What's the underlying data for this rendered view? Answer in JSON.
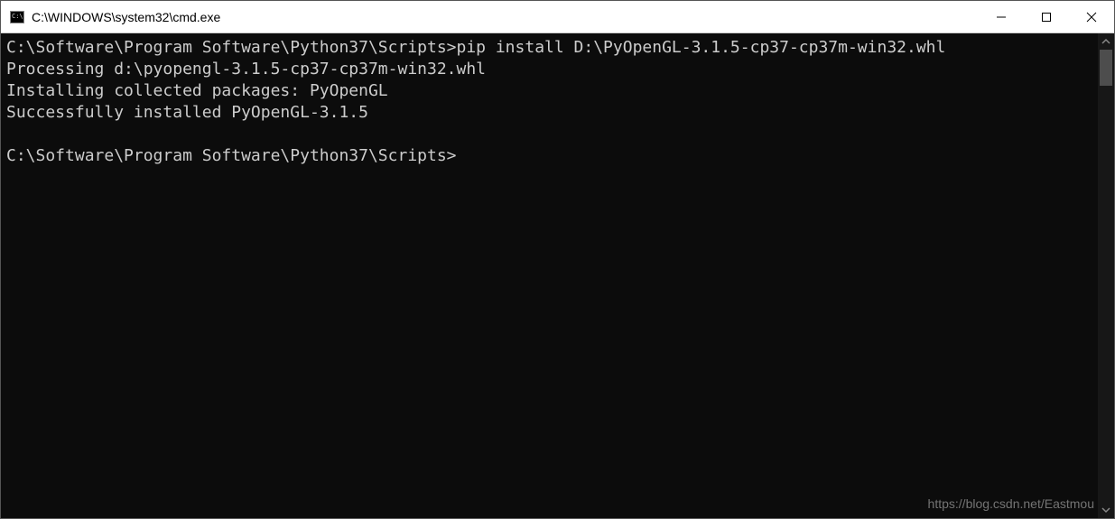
{
  "titlebar": {
    "title": "C:\\WINDOWS\\system32\\cmd.exe"
  },
  "console": {
    "lines": [
      {
        "prompt": "C:\\Software\\Program Software\\Python37\\Scripts>",
        "command": "pip install D:\\PyOpenGL-3.1.5-cp37-cp37m-win32.whl"
      },
      {
        "text": "Processing d:\\pyopengl-3.1.5-cp37-cp37m-win32.whl"
      },
      {
        "text": "Installing collected packages: PyOpenGL"
      },
      {
        "text": "Successfully installed PyOpenGL-3.1.5"
      },
      {
        "text": ""
      },
      {
        "prompt": "C:\\Software\\Program Software\\Python37\\Scripts>",
        "command": ""
      }
    ]
  },
  "watermark": "https://blog.csdn.net/Eastmou"
}
